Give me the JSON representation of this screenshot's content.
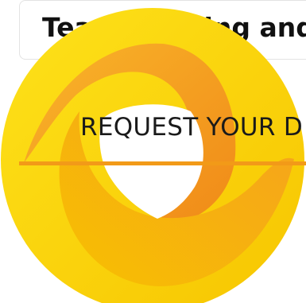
{
  "header": {
    "title": "Team Building and Ke"
  },
  "cta": {
    "label": "REQUEST YOUR D"
  },
  "colors": {
    "gold": "#fcd000",
    "gold_dark": "#f7c500",
    "orange": "#f29a18",
    "orange_light": "#f9b52a",
    "border": "#e3e3e3"
  },
  "icons": {
    "logo": "swirl-ring-logo"
  }
}
